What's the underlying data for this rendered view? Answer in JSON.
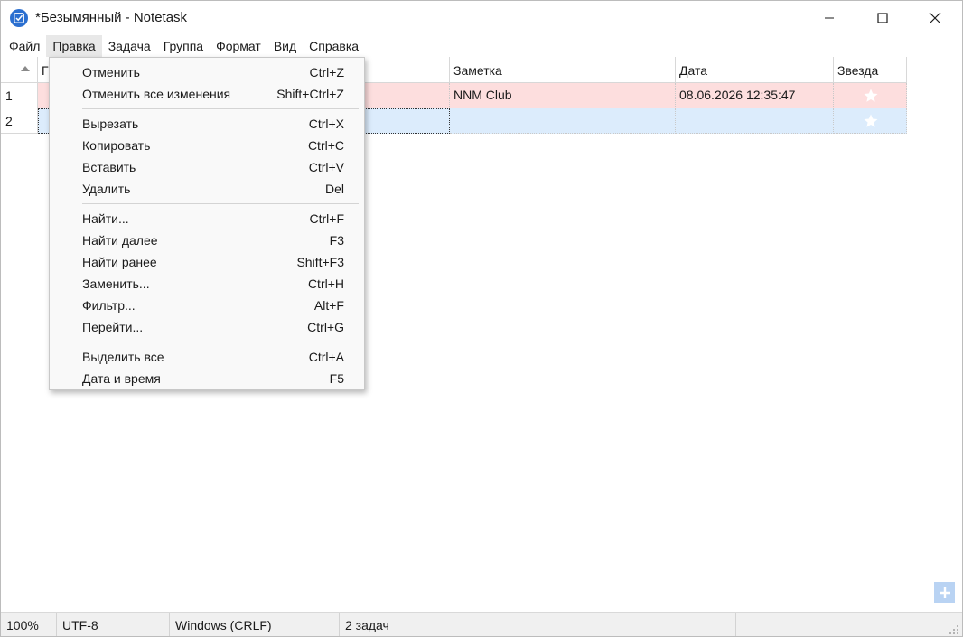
{
  "window": {
    "title": "*Безымянный - Notetask"
  },
  "menubar": {
    "items": [
      "Файл",
      "Правка",
      "Задача",
      "Группа",
      "Формат",
      "Вид",
      "Справка"
    ]
  },
  "table": {
    "headers": [
      "Г",
      "Заметка",
      "Дата",
      "Звезда"
    ],
    "rows": [
      {
        "num": "1",
        "note": "NNM Club",
        "date": "08.06.2026 12:35:47"
      },
      {
        "num": "2",
        "note": "",
        "date": ""
      }
    ]
  },
  "edit_menu": {
    "items": [
      {
        "label": "Отменить",
        "shortcut": "Ctrl+Z"
      },
      {
        "label": "Отменить все изменения",
        "shortcut": "Shift+Ctrl+Z"
      },
      {
        "label": "Вырезать",
        "shortcut": "Ctrl+X"
      },
      {
        "label": "Копировать",
        "shortcut": "Ctrl+C"
      },
      {
        "label": "Вставить",
        "shortcut": "Ctrl+V"
      },
      {
        "label": "Удалить",
        "shortcut": "Del"
      },
      {
        "label": "Найти...",
        "shortcut": "Ctrl+F"
      },
      {
        "label": "Найти далее",
        "shortcut": "F3"
      },
      {
        "label": "Найти ранее",
        "shortcut": "Shift+F3"
      },
      {
        "label": "Заменить...",
        "shortcut": "Ctrl+H"
      },
      {
        "label": "Фильтр...",
        "shortcut": "Alt+F"
      },
      {
        "label": "Перейти...",
        "shortcut": "Ctrl+G"
      },
      {
        "label": "Выделить все",
        "shortcut": "Ctrl+A"
      },
      {
        "label": "Дата и время",
        "shortcut": "F5"
      }
    ]
  },
  "statusbar": {
    "zoom": "100%",
    "encoding": "UTF-8",
    "line_endings": "Windows (CRLF)",
    "task_count": "2 задач"
  },
  "colors": {
    "row_pink": "#fddede",
    "row_blue": "#dcecfc",
    "accent": "#2b6fd0"
  }
}
